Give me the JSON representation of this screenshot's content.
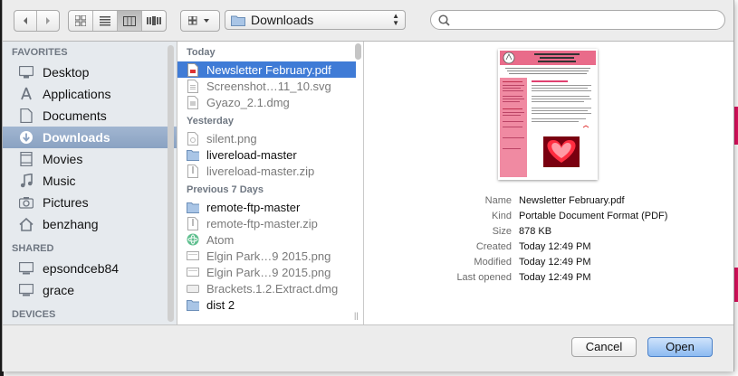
{
  "toolbar": {
    "current_folder": "Downloads",
    "search_placeholder": ""
  },
  "sidebar": {
    "sections": {
      "favorites": "FAVORITES",
      "shared": "SHARED",
      "devices": "DEVICES"
    },
    "favorites": [
      "Desktop",
      "Applications",
      "Documents",
      "Downloads",
      "Movies",
      "Music",
      "Pictures",
      "benzhang"
    ],
    "shared": [
      "epsondceb84",
      "grace"
    ],
    "selected": "Downloads"
  },
  "files": {
    "groups": {
      "today": "Today",
      "yesterday": "Yesterday",
      "previous7": "Previous 7 Days"
    },
    "today": [
      "Newsletter February.pdf",
      "Screenshot…11_10.svg",
      "Gyazo_2.1.dmg"
    ],
    "yesterday": [
      "silent.png",
      "livereload-master",
      "livereload-master.zip"
    ],
    "previous7": [
      "remote-ftp-master",
      "remote-ftp-master.zip",
      "Atom",
      "Elgin Park…9 2015.png",
      "Elgin Park…9 2015.png",
      "Brackets.1.2.Extract.dmg",
      "dist 2"
    ]
  },
  "preview": {
    "labels": {
      "name": "Name",
      "kind": "Kind",
      "size": "Size",
      "created": "Created",
      "modified": "Modified",
      "last_opened": "Last opened"
    },
    "values": {
      "name": "Newsletter February.pdf",
      "kind": "Portable Document Format (PDF)",
      "size": "878 KB",
      "created": "Today 12:49 PM",
      "modified": "Today 12:49 PM",
      "last_opened": "Today 12:49 PM"
    }
  },
  "footer": {
    "cancel": "Cancel",
    "open": "Open"
  },
  "colors": {
    "selection": "#3f7bd6",
    "sidebar_selection": "#8aa2c2",
    "newsletter_pink": "#e96b8a"
  }
}
